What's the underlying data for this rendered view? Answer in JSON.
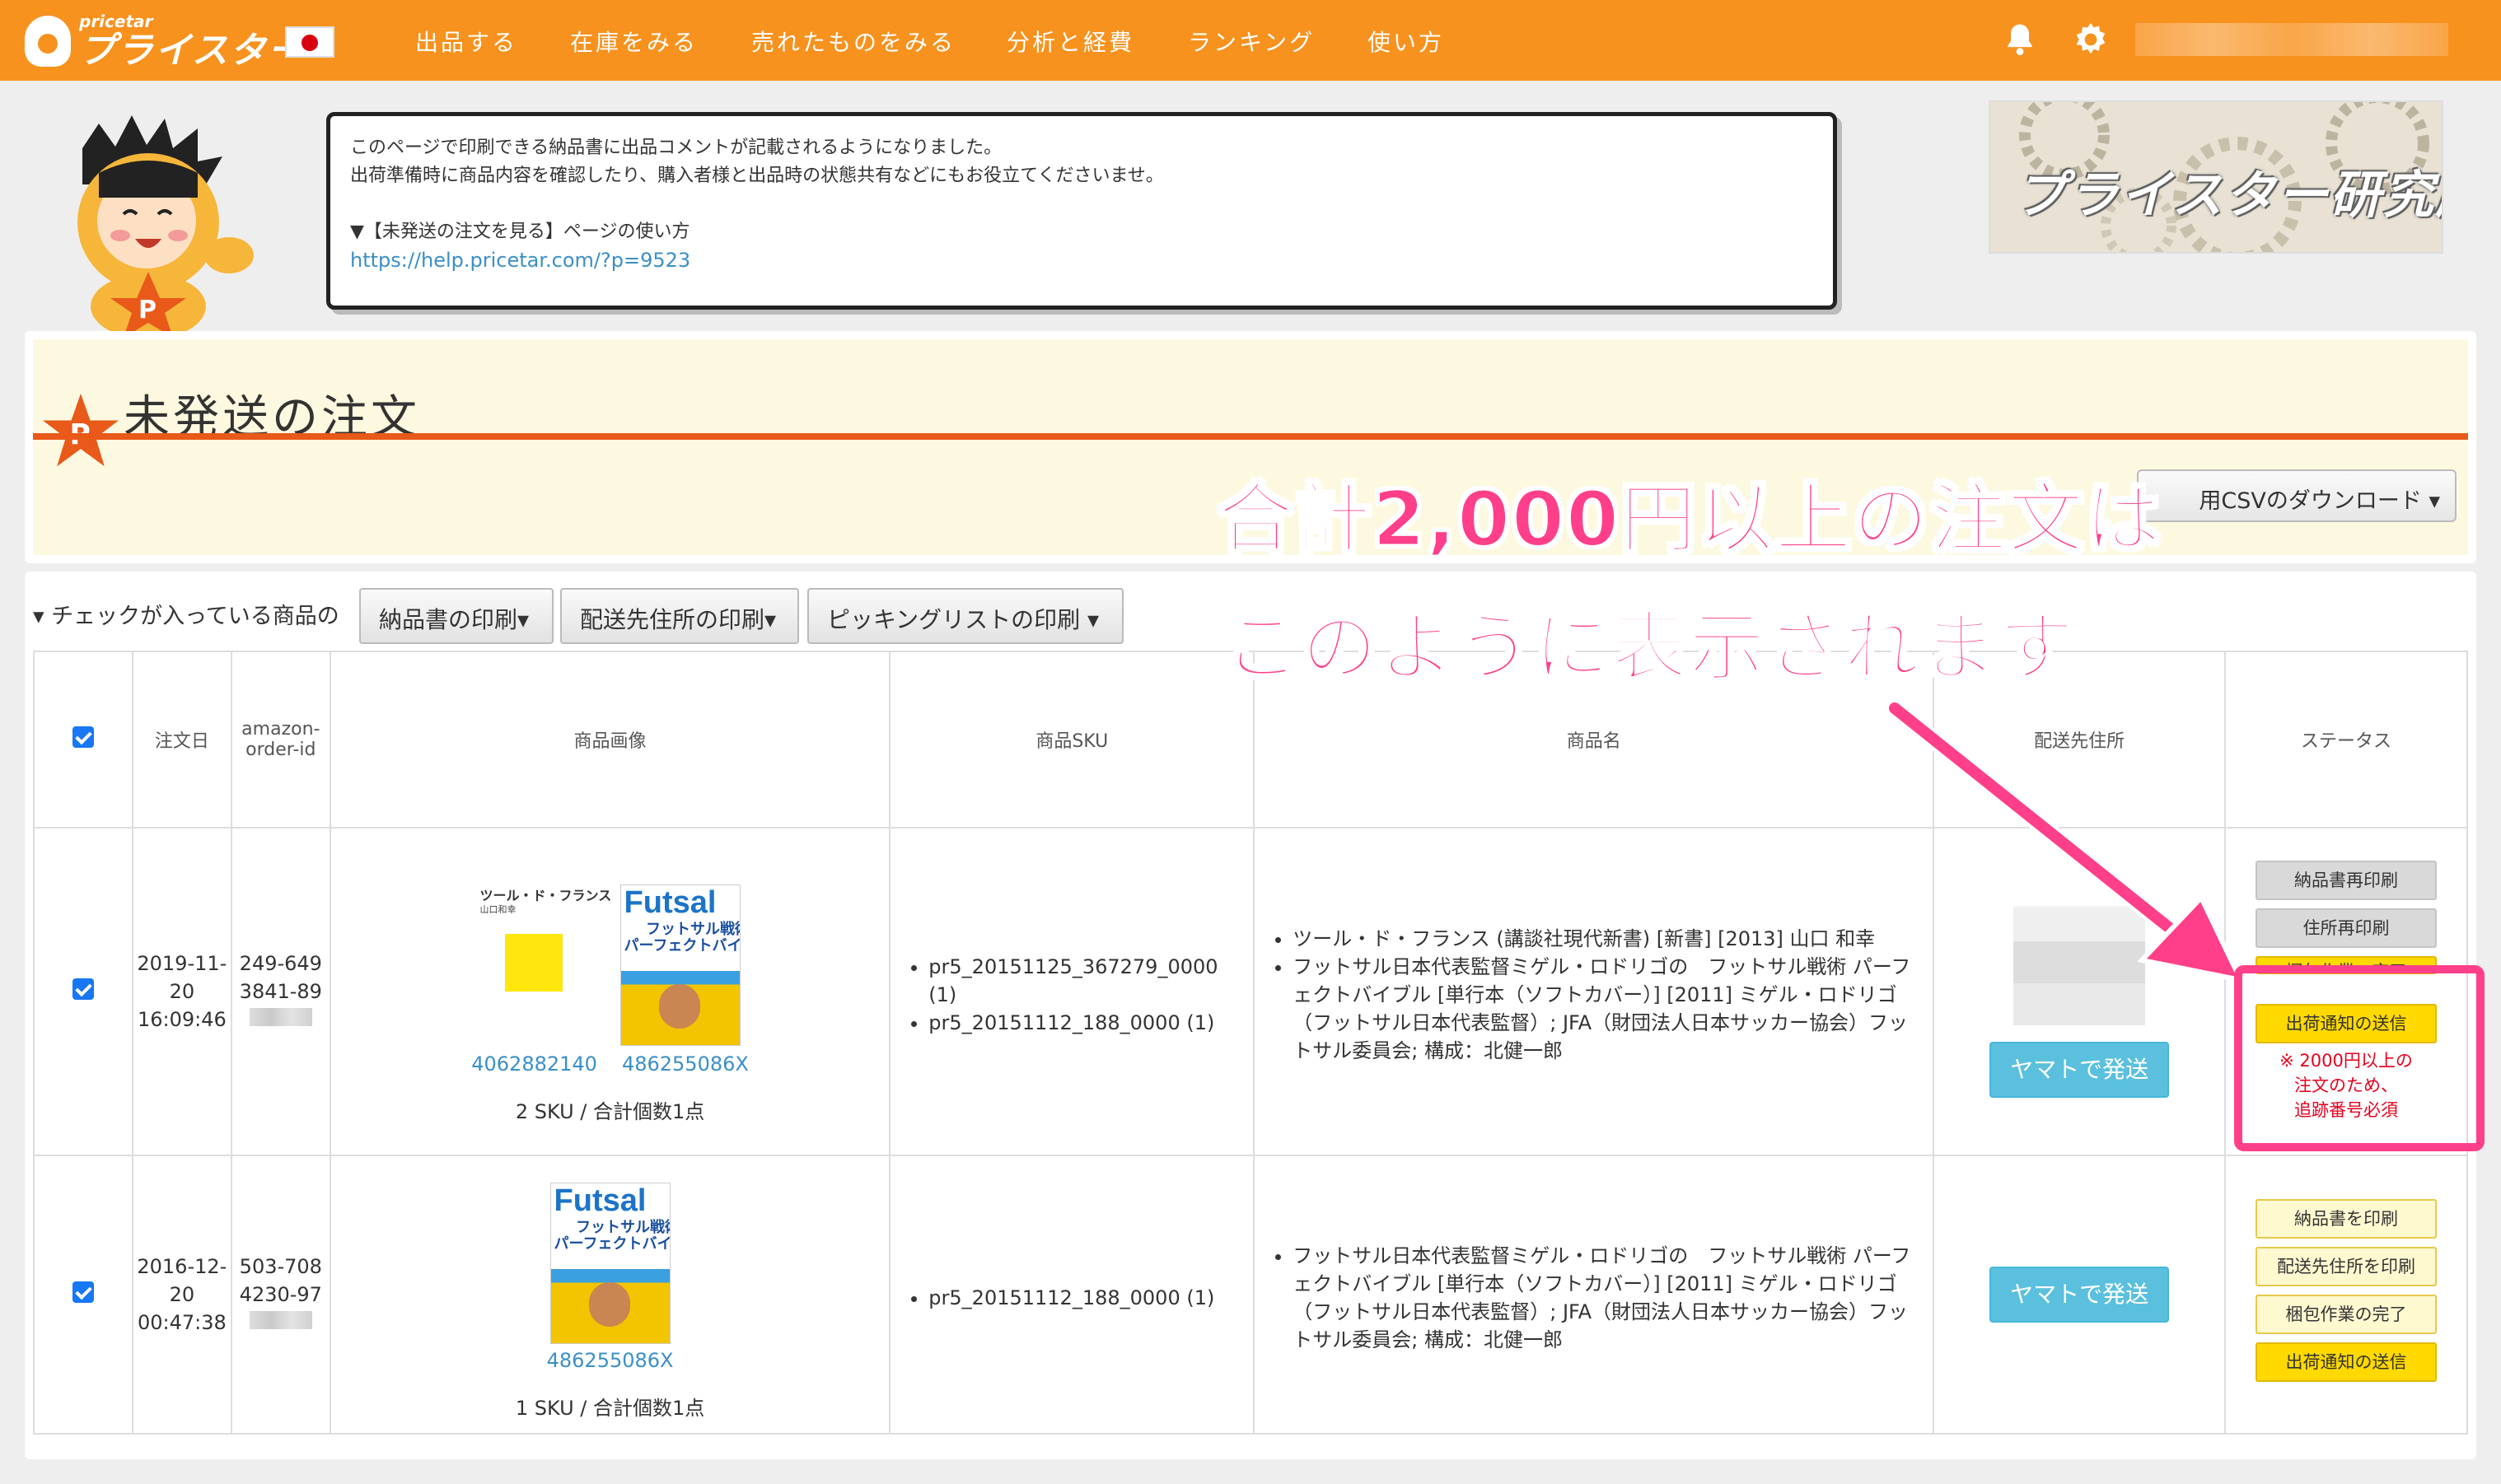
{
  "nav": {
    "logo_small": "pricetar",
    "logo_big": "プライスター",
    "items": [
      "出品する",
      "在庫をみる",
      "売れたものをみる",
      "分析と経費",
      "ランキング",
      "使い方"
    ]
  },
  "notice": {
    "line1": "このページで印刷できる納品書に出品コメントが記載されるようになりました。",
    "line2": "出荷準備時に商品内容を確認したり、購入者様と出品時の状態共有などにもお役立てくださいませ。",
    "line3": "▼【未発送の注文を見る】ページの使い方",
    "link": "https://help.pricetar.com/?p=9523"
  },
  "lab_banner": "プライスター研究所",
  "page_title": "未発送の注文",
  "csv_button": "用CSVのダウンロード",
  "annotation": {
    "line1": "合計2,000円以上の注文は",
    "line2": "このように表示されます"
  },
  "bulk": {
    "label": "▾ チェックが入っている商品の",
    "buttons": [
      "納品書の印刷▾",
      "配送先住所の印刷▾",
      "ピッキングリストの印刷 ▾"
    ]
  },
  "table": {
    "headers": [
      "注文日",
      "amazon-order-id",
      "商品画像",
      "商品SKU",
      "商品名",
      "配送先住所",
      "ステータス"
    ],
    "rows": [
      {
        "date": "2019-11-20",
        "time": "16:09:46",
        "order_id_1": "249-649",
        "order_id_2": "3841-89",
        "book1_title": "ツール・ド・フランス",
        "book1_author": "山口和幸",
        "asin1": "4062882140",
        "asin2": "486255086X",
        "sku_count": "2 SKU / 合計個数1点",
        "skus": [
          "pr5_20151125_367279_0000 (1)",
          "pr5_20151112_188_0000 (1)"
        ],
        "names": [
          "ツール・ド・フランス (講談社現代新書) [新書] [2013] 山口 和幸",
          "フットサル日本代表監督ミゲル・ロドリゴの　フットサル戦術 パーフェクトバイブル [単行本（ソフトカバー）] [2011] ミゲル・ロドリゴ（フットサル日本代表監督）; JFA（財団法人日本サッカー協会）フットサル委員会; 構成：北健一郎"
        ],
        "ship_button": "ヤマトで発送",
        "status_buttons": [
          "納品書再印刷",
          "住所再印刷",
          "梱包作業の完了",
          "出荷通知の送信"
        ],
        "warning": [
          "※ 2000円以上の",
          "注文のため、",
          "追跡番号必須"
        ]
      },
      {
        "date": "2016-12-20",
        "time": "00:47:38",
        "order_id_1": "503-708",
        "order_id_2": "4230-97",
        "asin1": "486255086X",
        "sku_count": "1 SKU / 合計個数1点",
        "skus": [
          "pr5_20151112_188_0000 (1)"
        ],
        "names": [
          "フットサル日本代表監督ミゲル・ロドリゴの　フットサル戦術 パーフェクトバイブル [単行本（ソフトカバー）] [2011] ミゲル・ロドリゴ（フットサル日本代表監督）; JFA（財団法人日本サッカー協会）フットサル委員会; 構成：北健一郎"
        ],
        "ship_button": "ヤマトで発送",
        "status_buttons": [
          "納品書を印刷",
          "配送先住所を印刷",
          "梱包作業の完了",
          "出荷通知の送信"
        ]
      }
    ]
  },
  "book_cover": {
    "futsal_title": "Futsal",
    "futsal_sub1": "フットサル戦術",
    "futsal_sub2": "パーフェクトバイブル"
  },
  "colors": {
    "topbar": "#f7921e",
    "accent_rule": "#e8591a",
    "annotation": "#ff3f8a",
    "yamato": "#5bc0de",
    "warning": "#e6001d"
  }
}
